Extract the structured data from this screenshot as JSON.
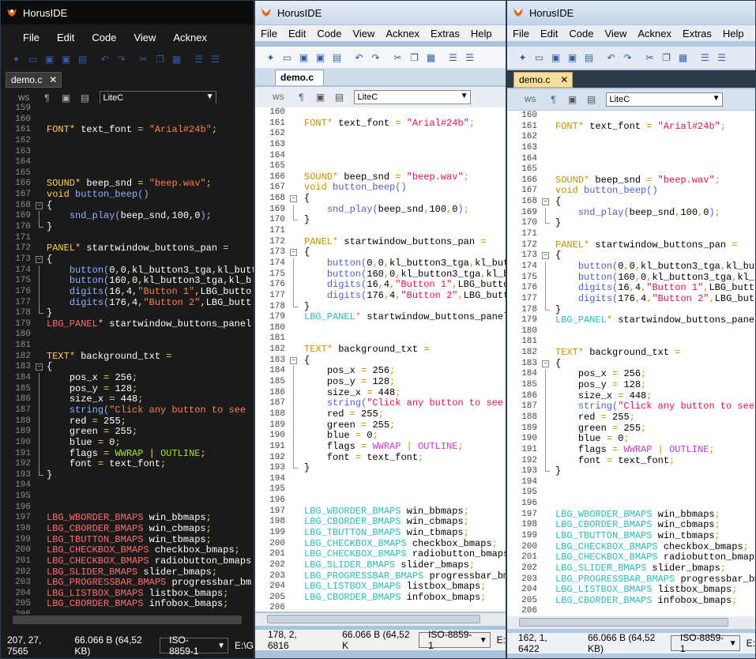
{
  "app_title": "HorusIDE",
  "menus_w1": [
    "File",
    "Edit",
    "Code",
    "View",
    "Acknex"
  ],
  "menus_w2": [
    "File",
    "Edit",
    "Code",
    "View",
    "Acknex",
    "Extras",
    "Help"
  ],
  "tab_label": "demo.c",
  "ws_label": "WS",
  "language": "LiteC",
  "status_w1": {
    "pos": "207,  27,  7565",
    "size": "66.066 B (64,52 KB)",
    "encoding": "ISO-8859-1",
    "tail": "E:\\G"
  },
  "status_w2": {
    "pos": "178,  2,  6816",
    "size": "66.066 B (64,52 K",
    "encoding": "ISO-8859-1",
    "tail": "E:"
  },
  "status_w3": {
    "pos": "162,  1,  6422",
    "size": "66.066 B (64,52 KB)",
    "encoding": "ISO-8859-1",
    "tail": "E:"
  },
  "code": [
    "159",
    "160",
    "161 FONT* text_font = \"Arial#24b\";",
    "162",
    "163",
    "164",
    "165",
    "166 SOUND* beep_snd = \"beep.wav\";",
    "167 void button_beep()",
    "168 {",
    "169     snd_play(beep_snd,100,0);",
    "170 }",
    "171",
    "172 PANEL* startwindow_buttons_pan =",
    "173 {",
    "174     button(0,0,kl_button3_tga,kl_butt",
    "175     button(160,0,kl_button3_tga,kl_b",
    "176     digits(16,4,\"Button 1\",LBG_butto",
    "177     digits(176,4,\"Button 2\",LBG_butt",
    "178 }",
    "179 LBG_PANEL* startwindow_buttons_panel",
    "180",
    "181",
    "182 TEXT* background_txt =",
    "183 {",
    "184     pos_x = 256;",
    "185     pos_y = 128;",
    "186     size_x = 448;",
    "187     string(\"Click any button to see",
    "188     red = 255;",
    "189     green = 255;",
    "190     blue = 0;",
    "191     flags = WWRAP | OUTLINE;",
    "192     font = text_font;",
    "193 }",
    "194",
    "195",
    "196",
    "197 LBG_WBORDER_BMAPS win_bbmaps;",
    "198 LBG_CBORDER_BMAPS win_cbmaps;",
    "199 LBG_TBUTTON_BMAPS win_tbmaps;",
    "200 LBG_CHECKBOX_BMAPS checkbox_bmaps;",
    "201 LBG_CHECKBOX_BMAPS radiobutton_bmaps",
    "202 LBG_SLIDER_BMAPS slider_bmaps;",
    "203 LBG_PROGRESSBAR_BMAPS progressbar_bm",
    "204 LBG_LISTBOX_BMAPS listbox_bmaps;",
    "205 LBG_CBORDER_BMAPS infobox_bmaps;",
    "206"
  ]
}
